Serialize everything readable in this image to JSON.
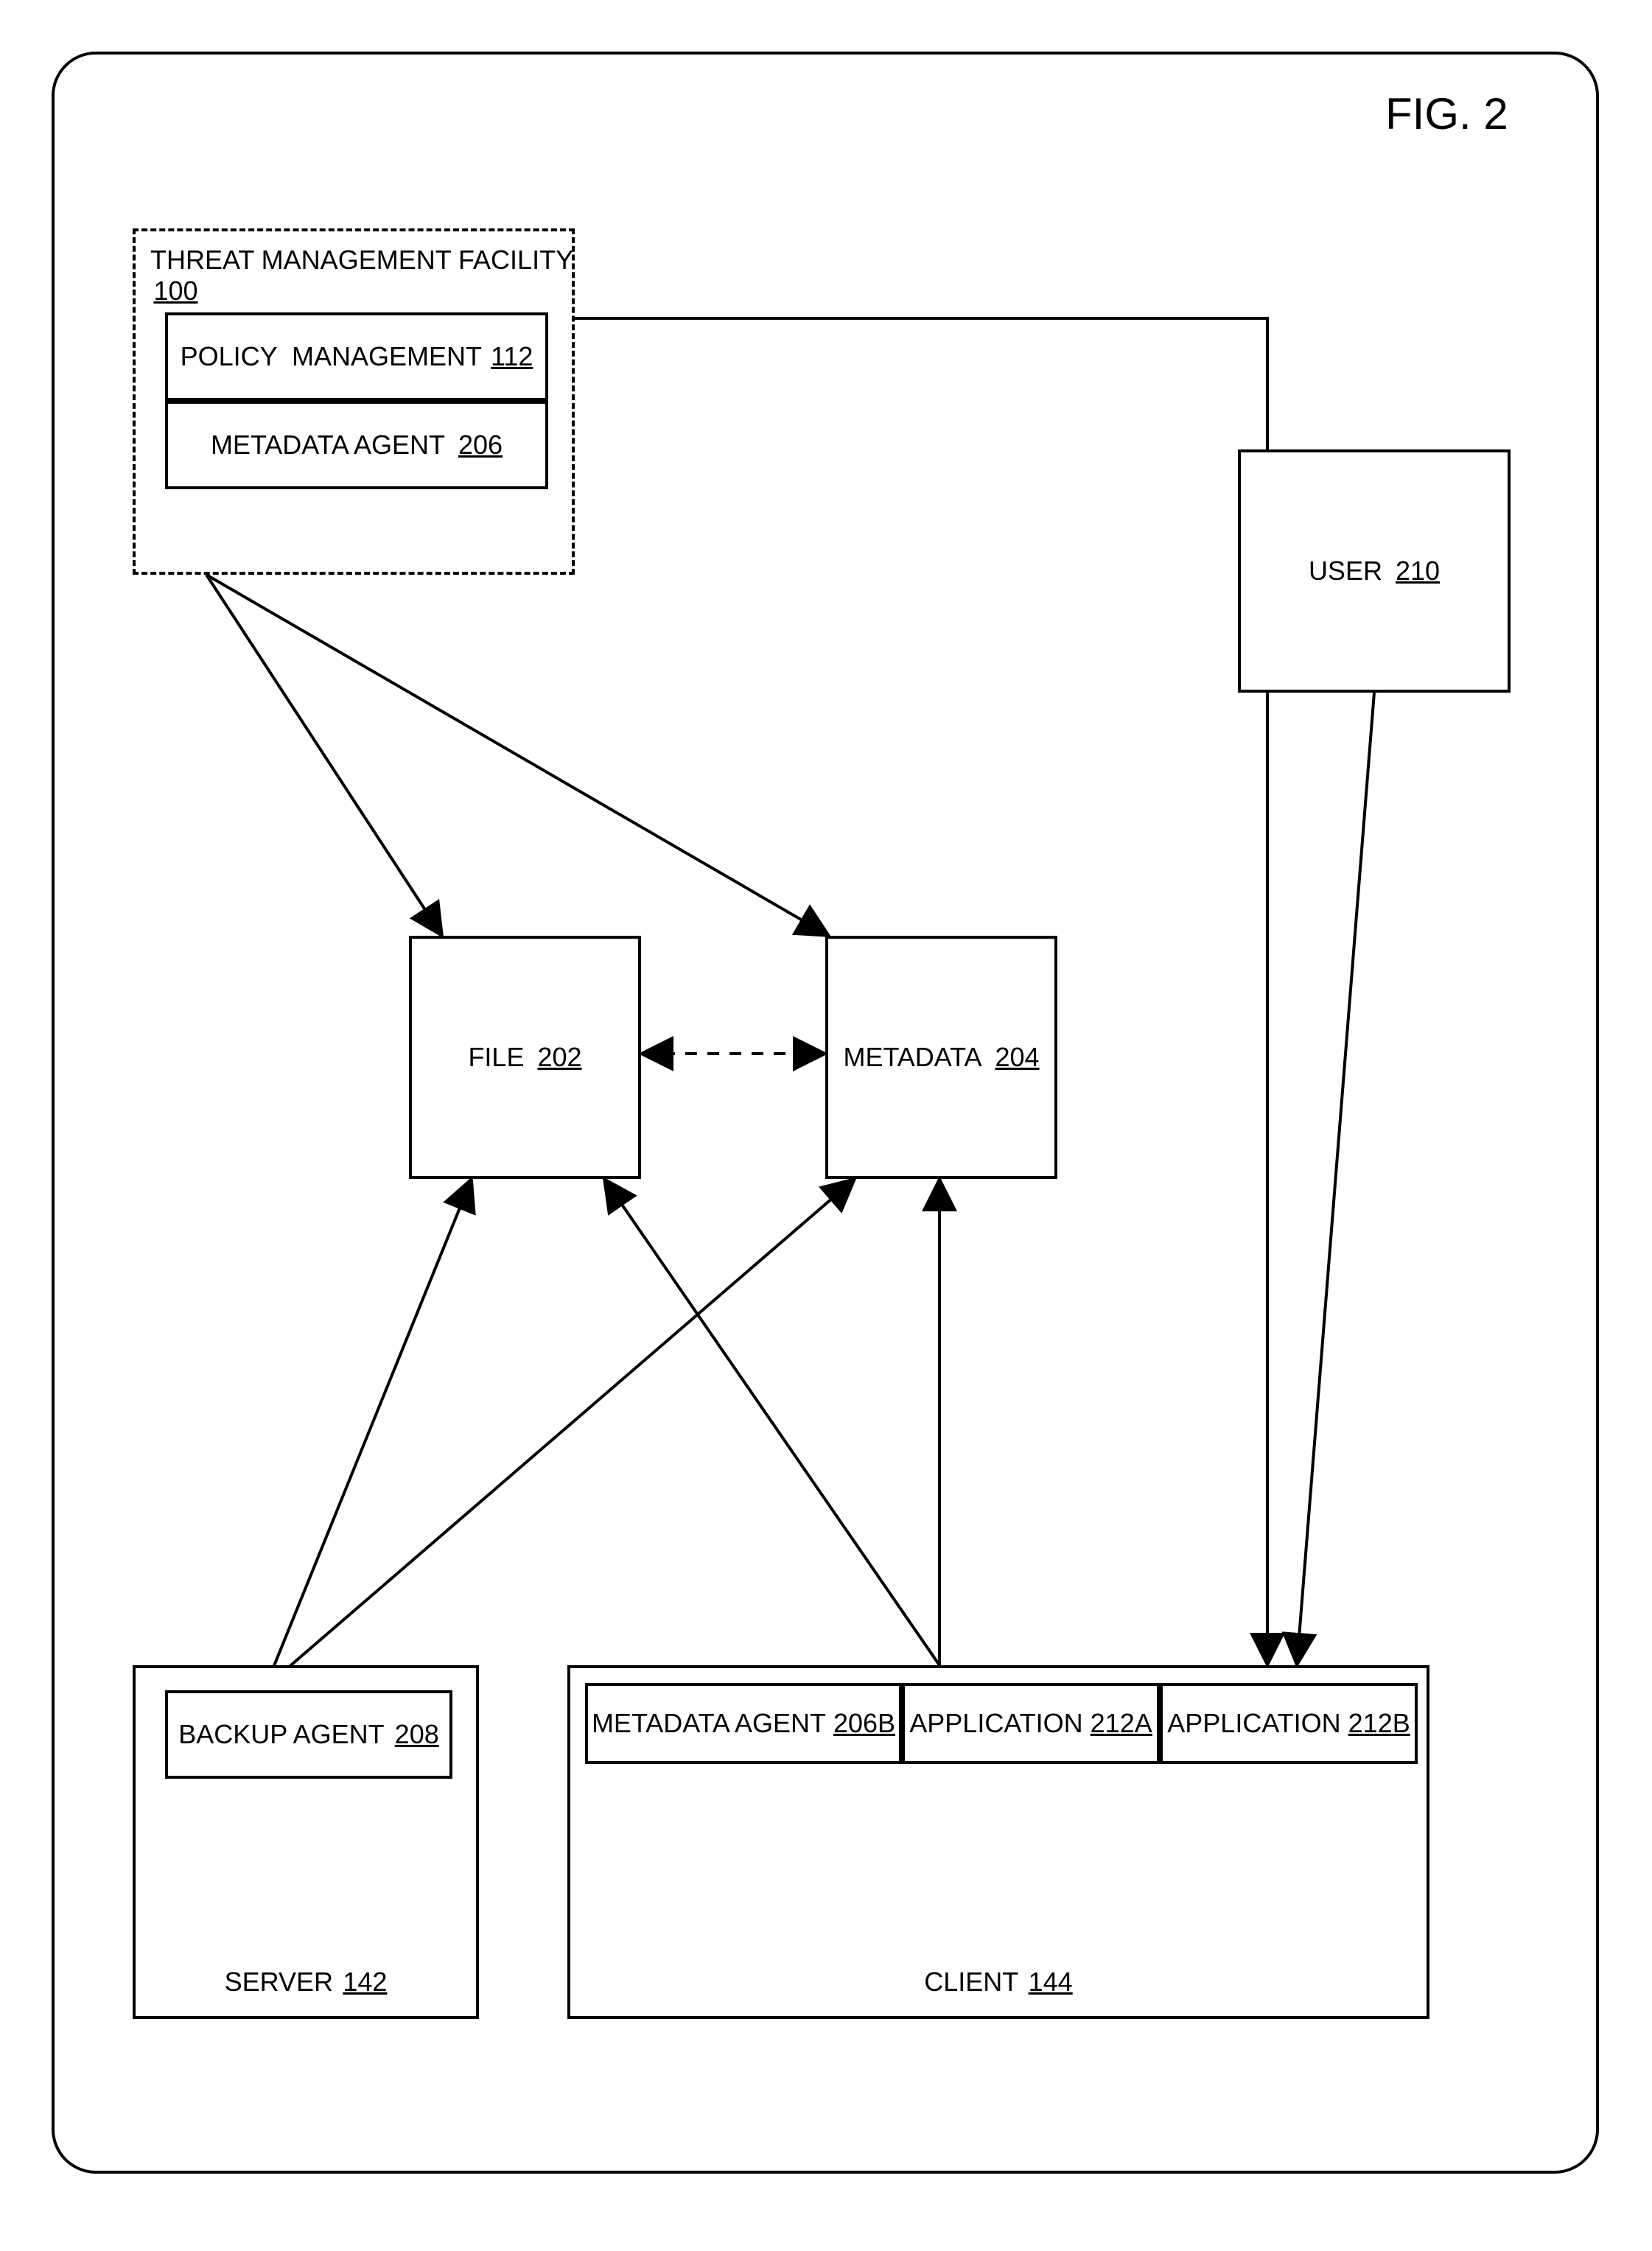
{
  "figure_label": "FIG. 2",
  "threat": {
    "title": "THREAT MANAGEMENT FACILITY",
    "num": "100",
    "policy": {
      "label": "POLICY  MANAGEMENT",
      "num": "112"
    },
    "agent": {
      "label": "METADATA AGENT",
      "num": "206"
    }
  },
  "file": {
    "label": "FILE",
    "num": "202"
  },
  "metadata": {
    "label": "METADATA",
    "num": "204"
  },
  "user": {
    "label": "USER",
    "num": "210"
  },
  "server": {
    "label": "SERVER",
    "num": "142",
    "backup": {
      "label": "BACKUP AGENT",
      "num": "208"
    }
  },
  "client": {
    "label": "CLIENT",
    "num": "144",
    "agent": {
      "label": "METADATA AGENT",
      "num": "206B"
    },
    "appA": {
      "label": "APPLICATION",
      "num": "212A"
    },
    "appB": {
      "label": "APPLICATION",
      "num": "212B"
    }
  }
}
